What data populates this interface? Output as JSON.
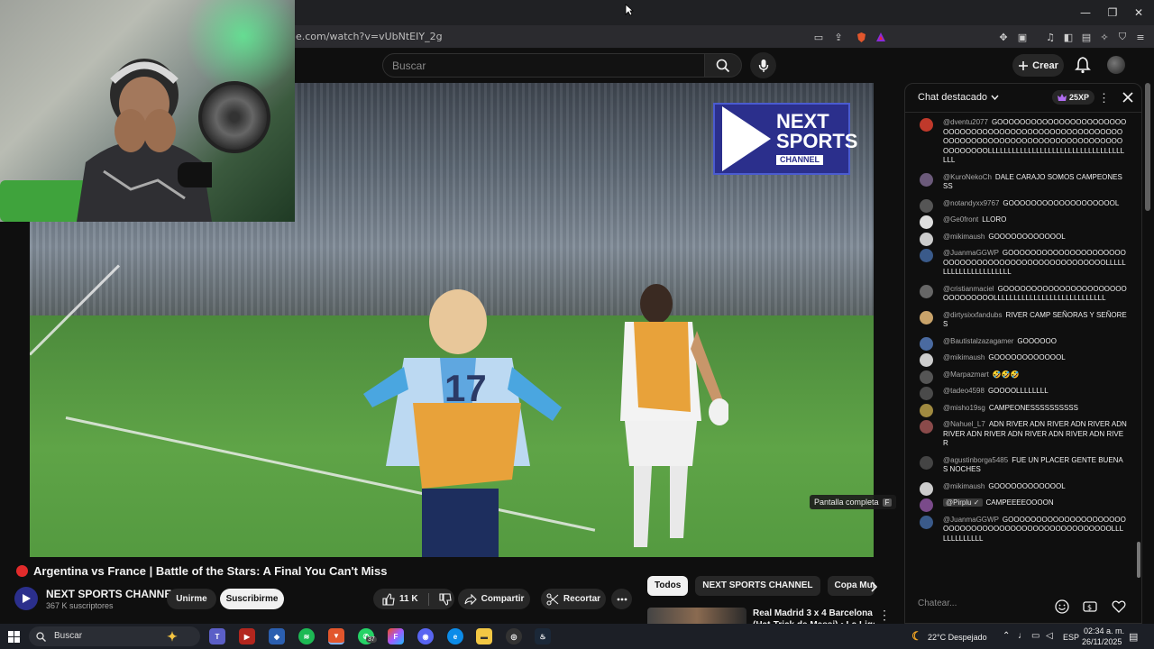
{
  "browser": {
    "url": "e.com/watch?v=vUbNtEIY_2g",
    "window_controls": [
      "—",
      "❐",
      "✕"
    ]
  },
  "header": {
    "search_placeholder": "Buscar",
    "create_label": "Crear"
  },
  "video": {
    "overlay_logo": {
      "line1": "NEXT",
      "line2": "SPORTS",
      "line3": "CHANNEL"
    },
    "fullscreen_tooltip": "Pantalla completa",
    "fullscreen_key": "F"
  },
  "info": {
    "title": "Argentina vs France | Battle of the Stars: A Final You Can't Miss",
    "channel_name": "NEXT SPORTS CHANNEL",
    "subscribers": "367 K suscriptores",
    "join_label": "Unirme",
    "subscribe_label": "Suscribirme",
    "likes": "11 K",
    "share_label": "Compartir",
    "clip_label": "Recortar"
  },
  "chips": [
    "Todos",
    "NEXT SPORTS CHANNEL",
    "Copa Mund"
  ],
  "recommendation": {
    "title_line1": "Real Madrid 3 x 4 Barcelona",
    "title_line2": "(Hat-Trick de Messi) • La Liga"
  },
  "chat": {
    "title": "Chat destacado",
    "xp": "25XP",
    "input_placeholder": "Chatear...",
    "messages": [
      {
        "author": "@dventu2077",
        "text": "GOOOOOOOOOOOOOOOOOOOOOOOOOOOOOOOOOOOOOOOOOOOOOOOOOOOOOOOOOOOOOOOOOOOOOOOOOOOOOOOOOOOOOOOOOOOOOOOLLLLLLLLLLLLLLLLLLLLLLLLLLLLLLLLLLLLL",
        "color": "#c0392b"
      },
      {
        "author": "@KuroNekoCh",
        "text": "DALE CARAJO SOMOS CAMPEONESSS",
        "color": "#6b5a7a"
      },
      {
        "author": "@notandyxx9767",
        "text": "GOOOOOOOOOOOOOOOOOOOL",
        "color": "#555555"
      },
      {
        "author": "@Ge0front",
        "text": "LLORO",
        "color": "#dddddd"
      },
      {
        "author": "@mikimaush",
        "text": "GOOOOOOOOOOOOL",
        "color": "#cccccc"
      },
      {
        "author": "@JuanmaGGWP",
        "text": "GOOOOOOOOOOOOOOOOOOOOOOOOOOOOOOOOOOOOOOOOOOOOOOOOOOLLLLLLLLLLLLLLLLLLLLLL",
        "color": "#3a5a8a"
      },
      {
        "author": "@cristianmaciel",
        "text": "GOOOOOOOOOOOOOOOOOOOOOOOOOOOOOOOLLLLLLLLLLLLLLLLLLLLLLLLLLLL",
        "color": "#666666"
      },
      {
        "author": "@dirtysixxfandubs",
        "text": "RIVER CAMP SEÑORAS Y SEÑORES",
        "color": "#c9a36a"
      },
      {
        "author": "@Bautistalzazagamer",
        "text": "GOOOOOO",
        "color": "#4a6aa0"
      },
      {
        "author": "@mikimaush",
        "text": "GOOOOOOOOOOOOL",
        "color": "#cccccc"
      },
      {
        "author": "@Marpazmart",
        "text": "🤣🤣🤣",
        "color": "#555555"
      },
      {
        "author": "@tadeo4598",
        "text": "GOOOOLLLLLLLL",
        "color": "#4a4a4a"
      },
      {
        "author": "@misho19sg",
        "text": "CAMPEONESSSSSSSSSS",
        "color": "#a08a40"
      },
      {
        "author": "@Nahuel_L7",
        "text": "ADN RIVER ADN RIVER ADN RIVER ADN RIVER ADN RIVER ADN RIVER ADN RIVER ADN RIVER",
        "color": "#8a4a4a"
      },
      {
        "author": "@agustinborga5485",
        "text": "FUE UN PLACER GENTE BUENAS NOCHES",
        "color": "#444444"
      },
      {
        "author": "@mikimaush",
        "text": "GOOOOOOOOOOOOL",
        "color": "#cccccc"
      },
      {
        "author": "@Pirplu ✓",
        "text": "CAMPEEEEOOOON",
        "color": "#7a4a8a"
      },
      {
        "author": "@JuanmaGGWP",
        "text": "GOOOOOOOOOOOOOOOOOOOOOOOOOOOOOOOOOOOOOOOOOOOOOOOOOOOLLLLLLLLLLLLL",
        "color": "#3a5a8a"
      }
    ]
  },
  "taskbar": {
    "search_placeholder": "Buscar",
    "whatsapp_badge": "37",
    "weather": "22°C Despejado",
    "language": "ESP",
    "time": "02:34 a. m.",
    "date": "26/11/2025"
  }
}
